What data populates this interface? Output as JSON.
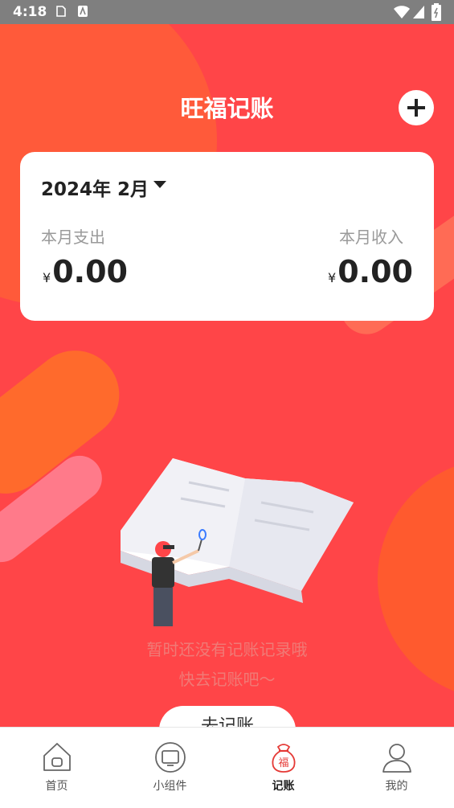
{
  "status_bar": {
    "time": "4:18"
  },
  "header": {
    "title": "旺福记账"
  },
  "summary": {
    "month": "2024年 2月",
    "expense_label": "本月支出",
    "income_label": "本月收入",
    "currency": "¥",
    "expense_value": "0.00",
    "income_value": "0.00"
  },
  "empty_state": {
    "line1": "暂时还没有记账记录哦",
    "line2": "快去记账吧～",
    "button_label": "去记账"
  },
  "tabs": [
    {
      "label": "首页",
      "icon": "home-icon"
    },
    {
      "label": "小组件",
      "icon": "widget-icon"
    },
    {
      "label": "记账",
      "icon": "lucky-bag-icon",
      "active": true,
      "glyph": "福"
    },
    {
      "label": "我的",
      "icon": "user-icon"
    }
  ],
  "colors": {
    "primary": "#ff4548",
    "accent_orange": "#ff6a2c",
    "text_dark": "#222222",
    "text_gray": "#9a9a9a"
  }
}
